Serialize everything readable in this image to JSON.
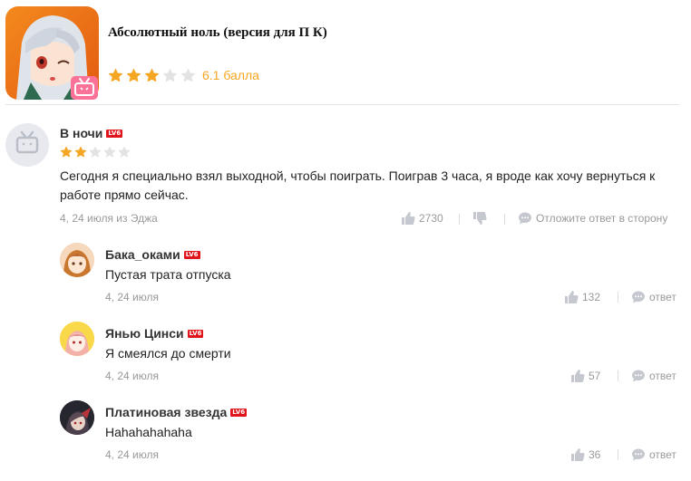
{
  "game": {
    "title": "Абсолютный ноль (версия для П К)",
    "rating_stars": 3,
    "rating_max": 5,
    "score_label": "6.1 балла"
  },
  "main_comment": {
    "username": "В ночи",
    "level": "LV6",
    "stars": 2,
    "stars_max": 5,
    "text": "Сегодня я специально взял выходной, чтобы поиграть. Поиграв 3 часа, я вроде как хочу вернуться к работе прямо сейчас.",
    "meta": "4, 24 июля из Эджа",
    "likes": "2730",
    "reply_label": "Отложите ответ в сторону"
  },
  "replies": [
    {
      "username": "Бака_оками",
      "level": "LV6",
      "text": "Пустая трата отпуска",
      "meta": "4, 24 июля",
      "likes": "132",
      "reply_label": "ответ"
    },
    {
      "username": "Янью Цинси",
      "level": "LV6",
      "text": "Я смеялся до смерти",
      "meta": "4, 24 июля",
      "likes": "57",
      "reply_label": "ответ"
    },
    {
      "username": "Платиновая звезда",
      "level": "LV6",
      "text": "Hahahahahaha",
      "meta": "4, 24 июля",
      "likes": "36",
      "reply_label": "ответ"
    }
  ],
  "colors": {
    "star_active": "#f5a623",
    "star_inactive": "#e3e3e3",
    "level_badge": "#e0141b",
    "muted_text": "#999999"
  },
  "icons": {
    "like": "thumb-up-icon",
    "dislike": "thumb-down-icon",
    "reply": "speech-bubble-icon",
    "platform": "bilibili-tv-icon"
  }
}
